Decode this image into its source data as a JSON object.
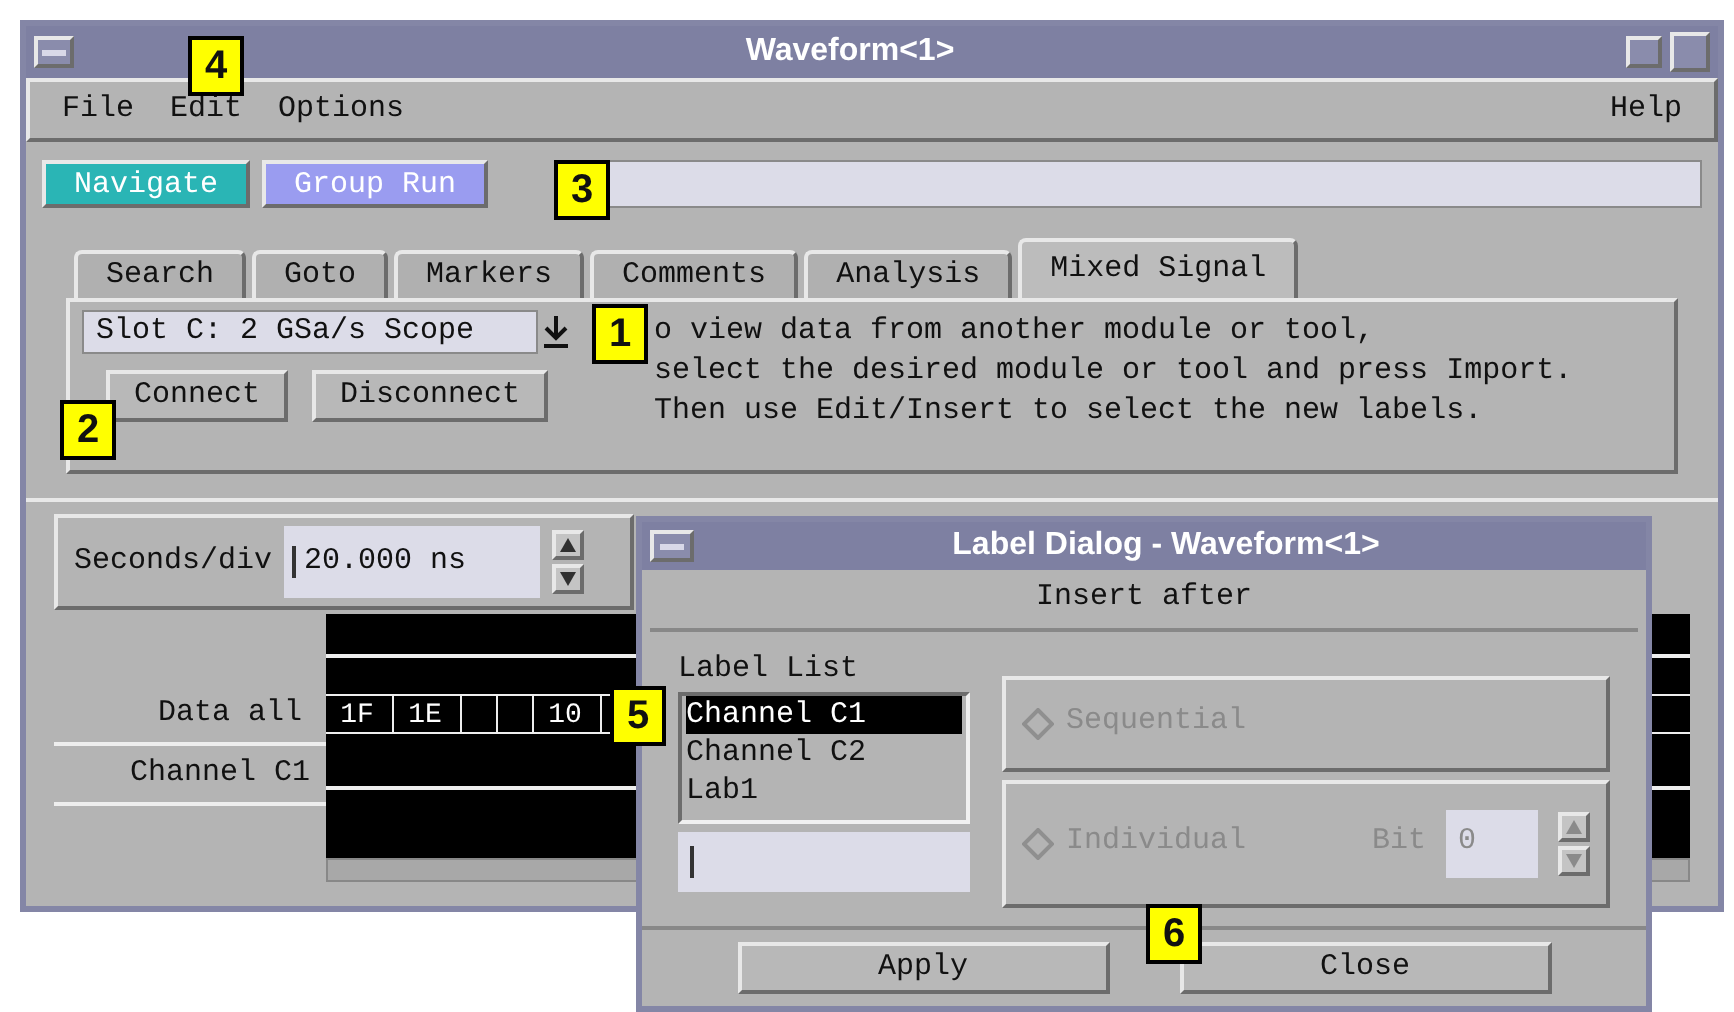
{
  "window": {
    "title": "Waveform<1>"
  },
  "menu": {
    "items": [
      "File",
      "Edit",
      "Options"
    ],
    "help": "Help"
  },
  "toolbar": {
    "buttons": [
      {
        "label": "Navigate",
        "color": "#2ab5b5"
      },
      {
        "label": "Group Run",
        "color": "#9a9cf0"
      }
    ]
  },
  "tabs": [
    {
      "label": "Search",
      "selected": false
    },
    {
      "label": "Goto",
      "selected": false
    },
    {
      "label": "Markers",
      "selected": false
    },
    {
      "label": "Comments",
      "selected": false
    },
    {
      "label": "Analysis",
      "selected": false
    },
    {
      "label": "Mixed Signal",
      "selected": true
    }
  ],
  "module_select": {
    "value": "Slot C: 2 GSa/s Scope"
  },
  "buttons": [
    "Connect",
    "Disconnect"
  ],
  "help_text": "o view data from another module or tool,\nselect the desired module or tool and press Import.\nThen use Edit/Insert to select the new labels.",
  "seconds_div": {
    "label": "Seconds/div",
    "value": "20.000 ns"
  },
  "waveform": {
    "rows": [
      {
        "label": "Data all"
      },
      {
        "label": "Channel C1"
      }
    ],
    "bus_values": [
      "1F",
      "1E",
      "10"
    ]
  },
  "dialog": {
    "title": "Label Dialog - Waveform<1>",
    "section": "Insert after",
    "list_label": "Label List",
    "labels": [
      {
        "label": "Channel C1",
        "selected": true
      },
      {
        "label": "Channel C2",
        "selected": false
      },
      {
        "label": "Lab1",
        "selected": false
      }
    ],
    "options": [
      {
        "label": "Sequential",
        "selected": false,
        "disabled": true
      },
      {
        "label": "Individual",
        "selected": false,
        "disabled": true
      }
    ],
    "bit": {
      "label": "Bit",
      "value": "0",
      "disabled": true
    },
    "buttons": [
      "Apply",
      "Close"
    ]
  },
  "callouts": [
    "1",
    "2",
    "3",
    "4",
    "5",
    "6"
  ]
}
